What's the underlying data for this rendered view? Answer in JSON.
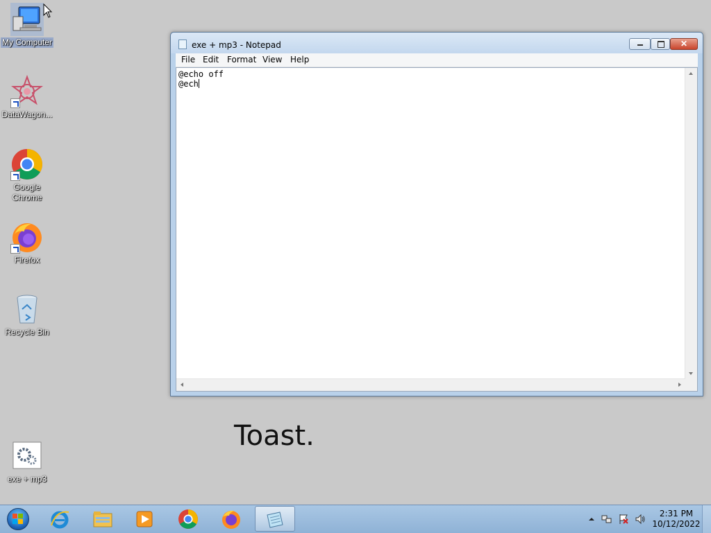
{
  "desktop": {
    "icons": [
      {
        "label": "My Computer",
        "icon": "computer-icon"
      },
      {
        "label": "DataWagon...",
        "icon": "datawagon-icon"
      },
      {
        "label": "Google Chrome",
        "icon": "chrome-icon"
      },
      {
        "label": "Firefox",
        "icon": "firefox-icon"
      },
      {
        "label": "Recycle Bin",
        "icon": "recycle-bin-icon"
      },
      {
        "label": "exe + mp3",
        "icon": "batch-file-icon"
      }
    ],
    "overlay_text": "Toast."
  },
  "notepad": {
    "title": "exe + mp3 - Notepad",
    "menu": [
      "File",
      "Edit",
      "Format",
      "View",
      "Help"
    ],
    "lines": [
      "@echo off",
      "@ech"
    ]
  },
  "taskbar": {
    "pinned": [
      {
        "name": "internet-explorer-icon"
      },
      {
        "name": "file-explorer-icon"
      },
      {
        "name": "media-player-icon"
      },
      {
        "name": "chrome-icon"
      },
      {
        "name": "firefox-icon"
      },
      {
        "name": "notepad-icon"
      }
    ],
    "clock": {
      "time": "2:31 PM",
      "date": "10/12/2022"
    }
  },
  "colors": {
    "desktop_bg": "#c9c9c9",
    "taskbar": "#9fbfe0",
    "window_frame": "#b9d1ea",
    "close_button": "#c8452c"
  }
}
